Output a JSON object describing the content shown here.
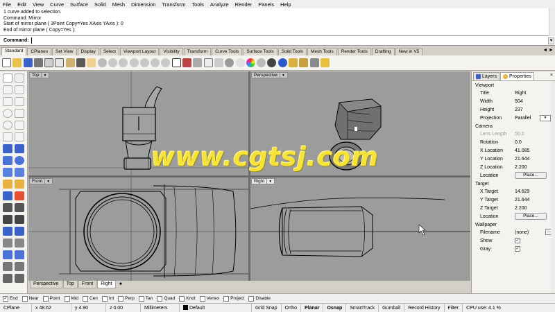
{
  "menu": [
    "File",
    "Edit",
    "View",
    "Curve",
    "Surface",
    "Solid",
    "Mesh",
    "Dimension",
    "Transform",
    "Tools",
    "Analyze",
    "Render",
    "Panels",
    "Help"
  ],
  "command_history": [
    "1 curve added to selection.",
    "Command: Mirror",
    "Start of mirror plane ( 3Point  Copy=Yes  XAxis  YAxis ): 0",
    "End of mirror plane ( Copy=Yes ):"
  ],
  "command_prompt": "Command:",
  "toolbar_tabs": [
    "Standard",
    "CPlanes",
    "Set View",
    "Display",
    "Select",
    "Viewport Layout",
    "Visibility",
    "Transform",
    "Curve Tools",
    "Surface Tools",
    "Solid Tools",
    "Mesh Tools",
    "Render Tools",
    "Drafting",
    "New in V5"
  ],
  "active_toolbar_tab": "Standard",
  "toolbar_nav": "◄ ►",
  "viewports": {
    "top": "Top",
    "perspective": "Perspective",
    "front": "Front",
    "right": "Right",
    "arrow": "▼"
  },
  "view_tabs": [
    "Perspective",
    "Top",
    "Front",
    "Right"
  ],
  "active_view_tab": "Right",
  "view_tab_add": "✦",
  "panel": {
    "tabs": [
      "Layers",
      "Properties"
    ],
    "active_tab": "Properties",
    "close": "×",
    "sections": {
      "viewport": {
        "heading": "Viewport",
        "rows": [
          {
            "label": "Title",
            "value": "Right"
          },
          {
            "label": "Width",
            "value": "504"
          },
          {
            "label": "Height",
            "value": "237"
          },
          {
            "label": "Projection",
            "value": "Parallel"
          }
        ]
      },
      "camera": {
        "heading": "Camera",
        "rows": [
          {
            "label": "Lens Length",
            "value": "50.0"
          },
          {
            "label": "Rotation",
            "value": "0.0"
          },
          {
            "label": "X Location",
            "value": "41.085"
          },
          {
            "label": "Y Location",
            "value": "21.644"
          },
          {
            "label": "Z Location",
            "value": "2.200"
          },
          {
            "label": "Location",
            "button": "Place..."
          }
        ]
      },
      "target": {
        "heading": "Target",
        "rows": [
          {
            "label": "X Target",
            "value": "14.629"
          },
          {
            "label": "Y Target",
            "value": "21.644"
          },
          {
            "label": "Z Target",
            "value": "2.200"
          },
          {
            "label": "Location",
            "button": "Place..."
          }
        ]
      },
      "wallpaper": {
        "heading": "Wallpaper",
        "rows": [
          {
            "label": "Filename",
            "value": "(none)"
          },
          {
            "label": "Show",
            "checked": true
          },
          {
            "label": "Gray",
            "checked": true
          }
        ]
      }
    }
  },
  "osnaps": [
    {
      "label": "End",
      "checked": true
    },
    {
      "label": "Near",
      "checked": false
    },
    {
      "label": "Point",
      "checked": false
    },
    {
      "label": "Mid",
      "checked": false
    },
    {
      "label": "Cen",
      "checked": false
    },
    {
      "label": "Int",
      "checked": false
    },
    {
      "label": "Perp",
      "checked": false
    },
    {
      "label": "Tan",
      "checked": false
    },
    {
      "label": "Quad",
      "checked": false
    },
    {
      "label": "Knot",
      "checked": false
    },
    {
      "label": "Vertex",
      "checked": false
    },
    {
      "label": "Project",
      "checked": false
    },
    {
      "label": "Disable",
      "checked": false
    }
  ],
  "status": {
    "cplane": "CPlane",
    "x": "x 48.62",
    "y": "y 4.90",
    "z": "z 0.00",
    "units": "Millimeters",
    "layer": "Default",
    "toggles": [
      {
        "label": "Grid Snap",
        "bold": false
      },
      {
        "label": "Ortho",
        "bold": false
      },
      {
        "label": "Planar",
        "bold": true
      },
      {
        "label": "Osnap",
        "bold": true
      },
      {
        "label": "SmartTrack",
        "bold": false
      },
      {
        "label": "Gumball",
        "bold": false
      },
      {
        "label": "Record History",
        "bold": false
      },
      {
        "label": "Filter",
        "bold": false
      }
    ],
    "cpu": "CPU use: 4.1 %"
  },
  "watermark": "www.cgtsj.com",
  "colors": {
    "viewport_bg": "#9c9c9c",
    "active_tab": "#f4f3ef",
    "watermark": "#f5e33b"
  }
}
